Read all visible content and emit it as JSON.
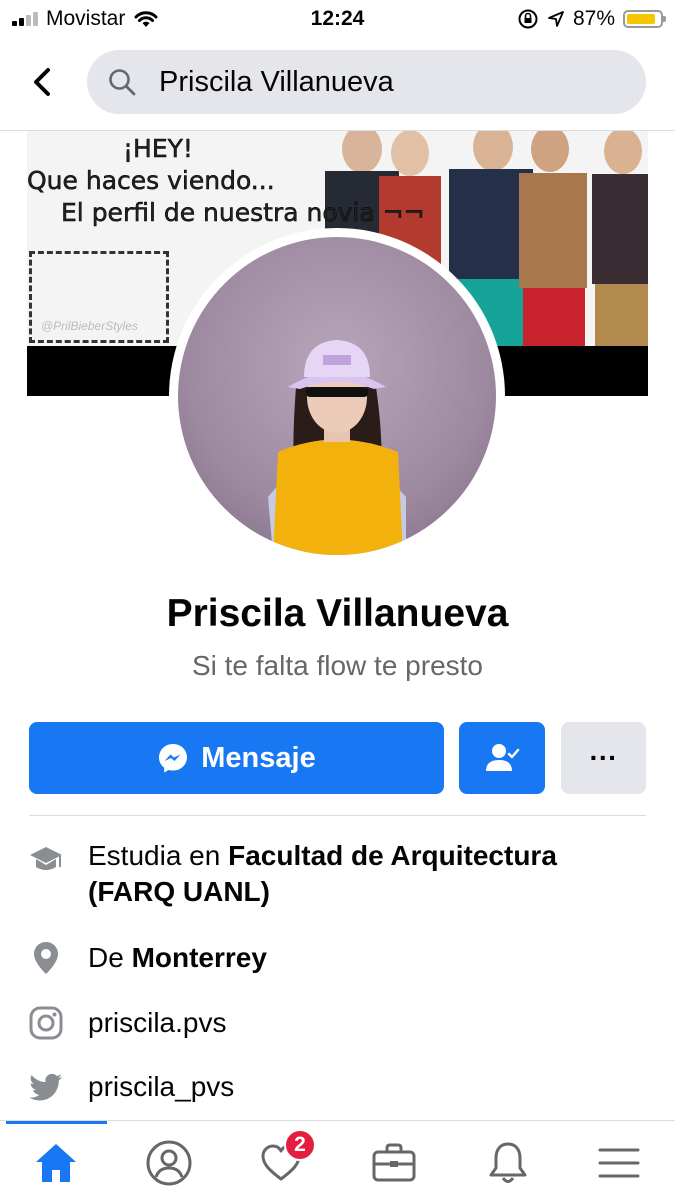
{
  "status": {
    "carrier": "Movistar",
    "time": "12:24",
    "battery": "87%",
    "battery_level": 0.87
  },
  "search": {
    "query": "Priscila Villanueva"
  },
  "cover": {
    "line1": "¡HEY!",
    "line2": "Que haces viendo...",
    "line3": "El perfil de nuestra novia ¬¬",
    "watermark": "@PrilBieberStyles"
  },
  "profile": {
    "name": "Priscila Villanueva",
    "bio": "Si te falta flow te presto"
  },
  "actions": {
    "message_label": "Mensaje",
    "more_label": "···"
  },
  "info": {
    "education_prefix": "Estudia en ",
    "education_place": "Facultad de Arquitectura (FARQ UANL)",
    "hometown_prefix": "De ",
    "hometown": "Monterrey",
    "instagram": "priscila.pvs",
    "twitter": "priscila_pvs"
  },
  "tabs": {
    "active": "home",
    "notifications_badge": "2"
  },
  "colors": {
    "accent": "#1877f2",
    "badge": "#e41e3f",
    "secondary_button": "#e4e6eb",
    "battery": "#f7c600"
  }
}
